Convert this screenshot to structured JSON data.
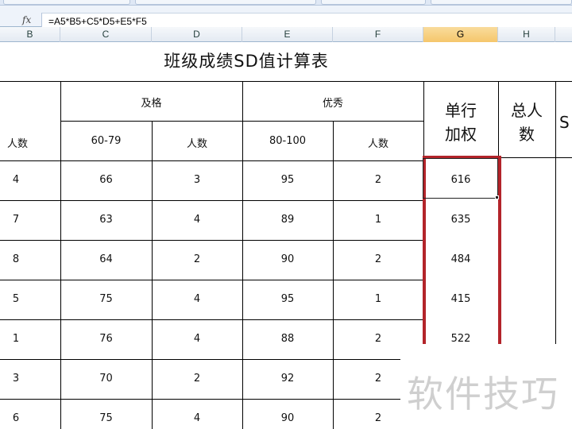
{
  "formula_bar": {
    "fx_label": "fx",
    "formula": "=A5*B5+C5*D5+E5*F5"
  },
  "columns": [
    "B",
    "C",
    "D",
    "E",
    "F",
    "G",
    "H"
  ],
  "selected_column": "G",
  "sheet": {
    "title": "班级成绩SD值计算表",
    "headers": {
      "pass_group": "及格",
      "excellent_group": "优秀",
      "weighted_line1": "单行",
      "weighted_line2": "加权",
      "total_line1": "总人",
      "total_line2": "数",
      "partial_s": "S",
      "count_b": "人数",
      "range_pass": "60-79",
      "count_d": "人数",
      "range_excellent": "80-100",
      "count_f": "人数"
    },
    "rows": [
      {
        "b": "4",
        "c": "66",
        "d": "3",
        "e": "95",
        "f": "2",
        "g": "616"
      },
      {
        "b": "7",
        "c": "63",
        "d": "4",
        "e": "89",
        "f": "1",
        "g": "635"
      },
      {
        "b": "8",
        "c": "64",
        "d": "2",
        "e": "90",
        "f": "2",
        "g": "484"
      },
      {
        "b": "5",
        "c": "75",
        "d": "4",
        "e": "95",
        "f": "1",
        "g": "415"
      },
      {
        "b": "1",
        "c": "76",
        "d": "4",
        "e": "88",
        "f": "2",
        "g": "522"
      },
      {
        "b": "3",
        "c": "70",
        "d": "2",
        "e": "92",
        "f": "2",
        "g": ""
      },
      {
        "b": "6",
        "c": "75",
        "d": "4",
        "e": "90",
        "f": "2",
        "g": ""
      }
    ]
  },
  "watermark": "软件技巧",
  "colors": {
    "highlight": "#b3242a",
    "selected_column": "#f5c66b",
    "watermark": "#cfcfcf"
  }
}
